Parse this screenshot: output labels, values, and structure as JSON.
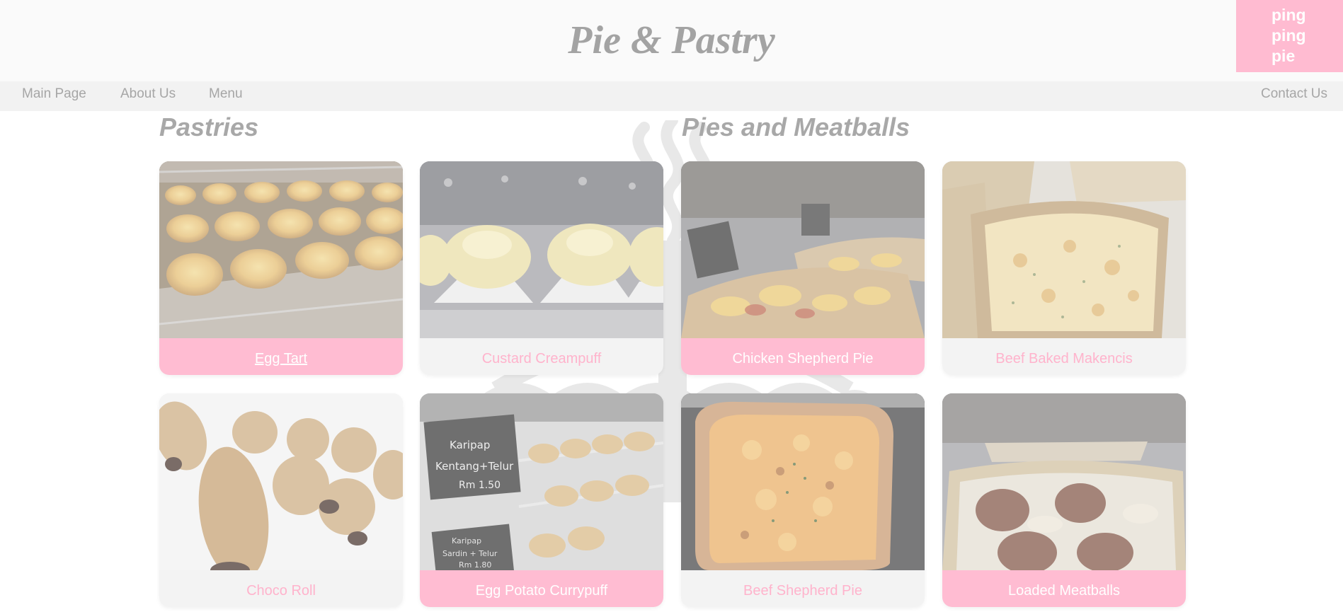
{
  "header": {
    "title": "Pie & Pastry",
    "logo_lines": [
      "ping",
      "ping",
      "pie"
    ]
  },
  "nav": {
    "items": [
      "Main Page",
      "About Us",
      "Menu"
    ],
    "contact": "Contact Us"
  },
  "sections": {
    "pastries_title": "Pastries",
    "pies_title": "Pies and Meatballs"
  },
  "cards": [
    {
      "label": "Egg Tart",
      "style": "pink",
      "icon": "egg-tart-photo"
    },
    {
      "label": "Custard Creampuff",
      "style": "plain",
      "icon": "creampuff-photo"
    },
    {
      "label": "Chicken Shepherd Pie",
      "style": "pink",
      "icon": "chicken-pie-photo"
    },
    {
      "label": "Beef Baked Makencis",
      "style": "plain",
      "icon": "beef-baked-photo"
    },
    {
      "label": "Choco Roll",
      "style": "plain",
      "icon": "choco-roll-photo"
    },
    {
      "label": "Egg Potato Currypuff",
      "style": "pink",
      "icon": "currypuff-photo"
    },
    {
      "label": "Beef Shepherd Pie",
      "style": "plain",
      "icon": "beef-pie-photo"
    },
    {
      "label": "Loaded Meatballs",
      "style": "pink",
      "icon": "meatballs-photo"
    }
  ],
  "photo_signs": {
    "top": [
      "Karipap",
      "Kentang+Telur",
      "Rm 1.50"
    ],
    "bottom": [
      "Karipap",
      "Sardin + Telur",
      "Rm 1.80"
    ]
  },
  "colors": {
    "accent_pink": "#ffbcd2",
    "pink_text": "#ffb3cc",
    "muted_gray": "#a6a6a6"
  }
}
